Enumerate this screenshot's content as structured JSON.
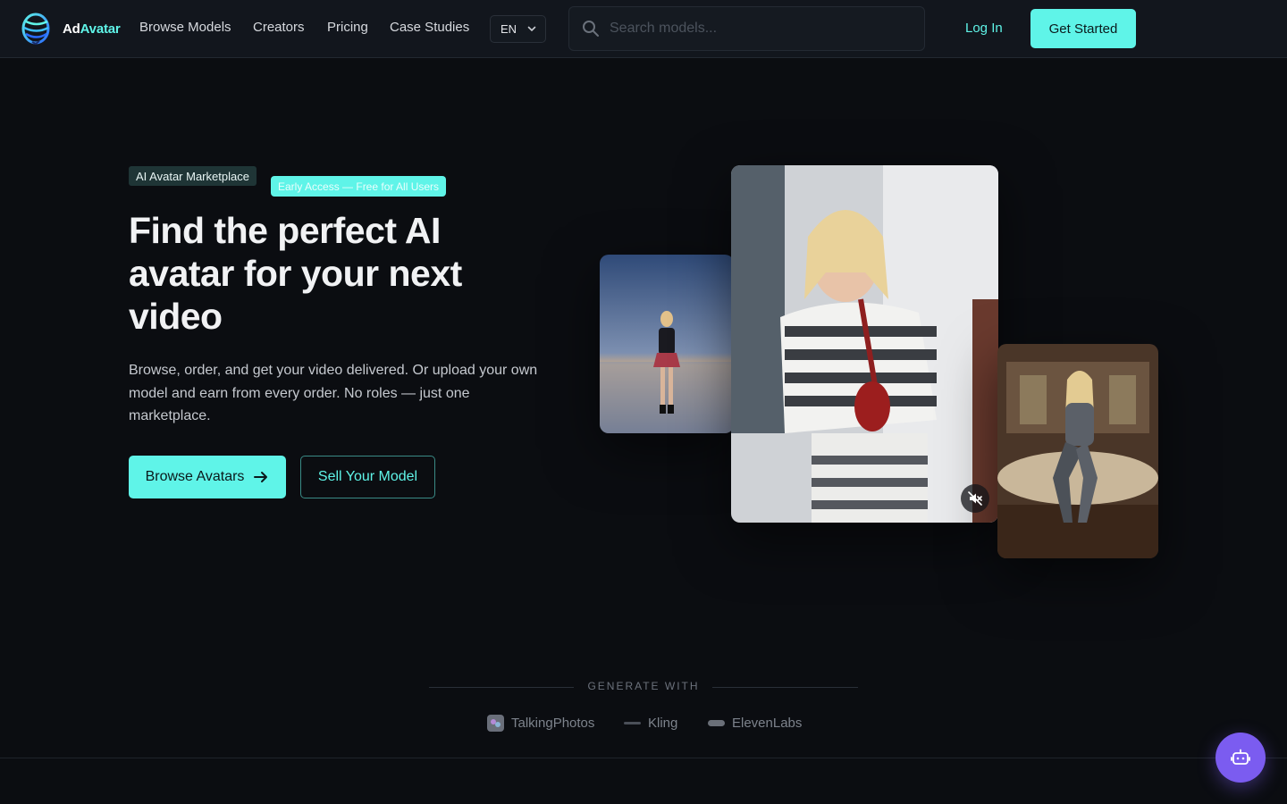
{
  "brand": {
    "name_part1": "Ad",
    "name_part2": "Avatar",
    "accent": "#5ff4e8"
  },
  "nav": {
    "links": [
      "Browse Models",
      "Creators",
      "Pricing",
      "Case Studies"
    ],
    "language": "EN",
    "search_placeholder": "Search models...",
    "login_label": "Log In",
    "get_started_label": "Get Started"
  },
  "hero": {
    "badge_marketplace": "AI Avatar Marketplace",
    "badge_early_access": "Early Access — Free for All Users",
    "title": "Find the perfect AI avatar for your next video",
    "description": "Browse, order, and get your video delivered. Or upload your own model and earn from every order. No roles — just one marketplace.",
    "browse_button": "Browse Avatars",
    "sell_button": "Sell Your Model"
  },
  "generate_with": {
    "label": "GENERATE WITH",
    "partners": [
      "TalkingPhotos",
      "Kling",
      "ElevenLabs"
    ]
  },
  "icons": {
    "logo": "brand-logo-icon",
    "search": "search-icon",
    "chevron": "chevron-down-icon",
    "arrow": "arrow-right-icon",
    "mute": "volume-muted-icon",
    "chat": "robot-chat-icon"
  },
  "colors": {
    "background": "#0b0d11",
    "nav": "#12161d",
    "accent": "#5ff4e8",
    "chat_button": "#7b5cf0"
  }
}
